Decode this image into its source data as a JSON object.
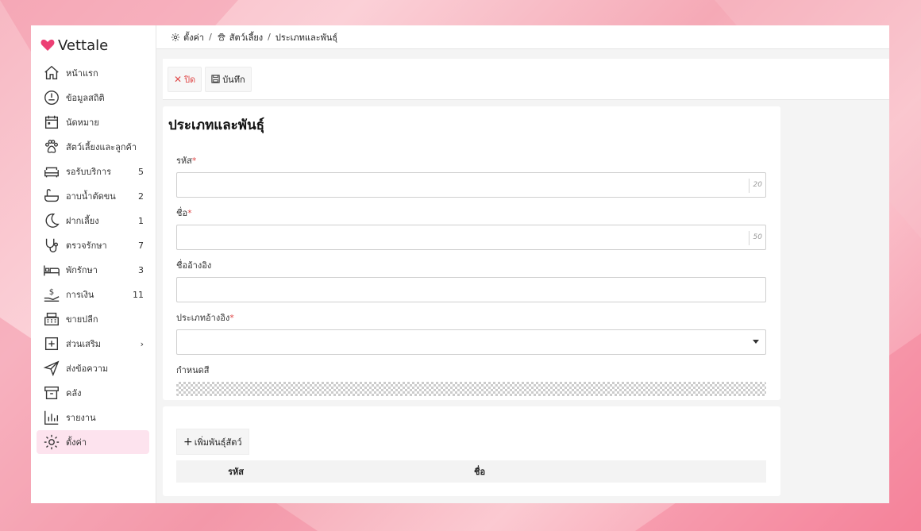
{
  "app": {
    "name": "Vettale",
    "brand_color": "#ec3f74"
  },
  "breadcrumb": {
    "items": [
      {
        "label": "ตั้งค่า",
        "icon": "gear-icon"
      },
      {
        "label": "สัตว์เลี้ยง",
        "icon": "paw-icon"
      },
      {
        "label": "ประเภทและพันธุ์"
      }
    ],
    "separator": "/"
  },
  "sidebar": {
    "items": [
      {
        "label": "หน้าแรก",
        "icon": "home-icon",
        "count": ""
      },
      {
        "label": "ข้อมูลสถิติ",
        "icon": "gauge-icon",
        "count": ""
      },
      {
        "label": "นัดหมาย",
        "icon": "calendar-icon",
        "count": ""
      },
      {
        "label": "สัตว์เลี้ยงและลูกค้า",
        "icon": "paw-icon",
        "count": ""
      },
      {
        "label": "รอรับบริการ",
        "icon": "sofa-icon",
        "count": "5"
      },
      {
        "label": "อาบน้ำตัดขน",
        "icon": "bathtub-icon",
        "count": "2"
      },
      {
        "label": "ฝากเลี้ยง",
        "icon": "moon-icon",
        "count": "1"
      },
      {
        "label": "ตรวจรักษา",
        "icon": "stethoscope-icon",
        "count": "7"
      },
      {
        "label": "พักรักษา",
        "icon": "bed-icon",
        "count": "3"
      },
      {
        "label": "การเงิน",
        "icon": "money-hand-icon",
        "count": "11"
      },
      {
        "label": "ขายปลีก",
        "icon": "cash-register-icon",
        "count": ""
      },
      {
        "label": "ส่วนเสริม",
        "icon": "plus-square-icon",
        "count": "›"
      },
      {
        "label": "ส่งข้อความ",
        "icon": "paper-plane-icon",
        "count": ""
      },
      {
        "label": "คลัง",
        "icon": "archive-icon",
        "count": ""
      },
      {
        "label": "รายงาน",
        "icon": "bar-chart-icon",
        "count": ""
      },
      {
        "label": "ตั้งค่า",
        "icon": "gear-icon",
        "count": "",
        "active": true
      }
    ]
  },
  "toolbar": {
    "close_label": "ปิด",
    "save_label": "บันทึก"
  },
  "form": {
    "title": "ประเภทและพันธุ์",
    "code": {
      "label": "รหัส",
      "required_mark": "*",
      "value": "",
      "max_length": "20"
    },
    "name": {
      "label": "ชื่อ",
      "required_mark": "*",
      "value": "",
      "max_length": "50"
    },
    "ref_name": {
      "label": "ชื่ออ้างอิง",
      "value": ""
    },
    "ref_type": {
      "label": "ประเภทอ้างอิง",
      "required_mark": "*",
      "value": ""
    },
    "color": {
      "label": "กำหนดสี"
    }
  },
  "breeds": {
    "add_label": "เพิ่มพันธุ์สัตว์",
    "columns": [
      "รหัส",
      "ชื่อ"
    ],
    "rows": []
  }
}
